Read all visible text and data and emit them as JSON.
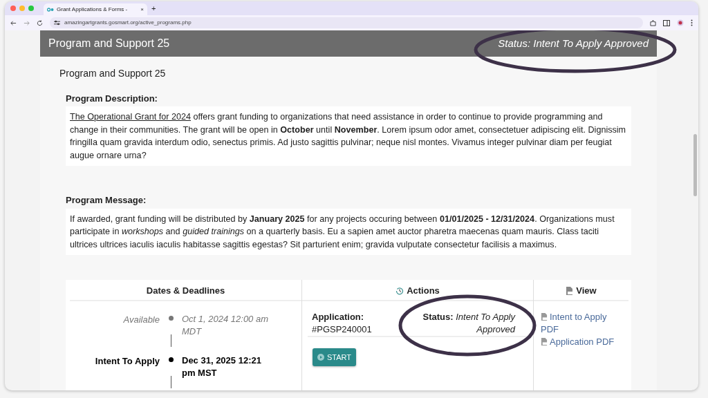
{
  "browser": {
    "tab_title": "Grant Applications & Forms -",
    "tab_close": "×",
    "new_tab": "+",
    "url": "amazingartgrants.gosmart.org/active_programs.php"
  },
  "header": {
    "title": "Program and Support 25",
    "status": "Status: Intent To Apply Approved"
  },
  "program_name": "Program and Support 25",
  "description": {
    "label": "Program Description:",
    "link": "The Operational Grant for 2024",
    "text": " offers grant funding to organizations that need assistance in order to continue to provide programming and change in their communities. The grant will be open in **October** until **November**. Lorem ipsum odor amet, consectetuer adipiscing elit. Dignissim fringilla quam gravida interdum odio, senectus primis. Ad justo sagittis pulvinar; neque nisl montes. Vivamus integer pulvinar diam per feugiat augue ornare urna?"
  },
  "message": {
    "label": "Program Message:",
    "text": "If awarded, grant funding will be distributed by **January 2025** for any projects occuring between **01/01/2025 - 12/31/2024**. Organizations must participate in *workshops* and *guided trainings* on a quarterly basis. Eu a sapien amet auctor pharetra maecenas quam mauris. Class taciti ultrices ultrices iaculis iaculis habitasse sagittis egestas? Sit parturient enim; gravida vulputate consectetur facilisis a maximus."
  },
  "table": {
    "columns": [
      "Dates & Deadlines",
      "Actions",
      "View"
    ],
    "timeline": [
      {
        "label": "Available",
        "date": "Oct 1, 2024 12:00 am MDT",
        "current": false
      },
      {
        "label": "Intent To Apply",
        "date": "Dec 31, 2025 12:21 pm MST",
        "current": true
      }
    ],
    "application_label": "Application:",
    "application_id": "#PGSP240001",
    "status_label": "Status:",
    "status_value": "Intent To Apply Approved",
    "start_button": "START",
    "view_links": [
      "Intent to Apply PDF",
      "Application PDF"
    ]
  }
}
